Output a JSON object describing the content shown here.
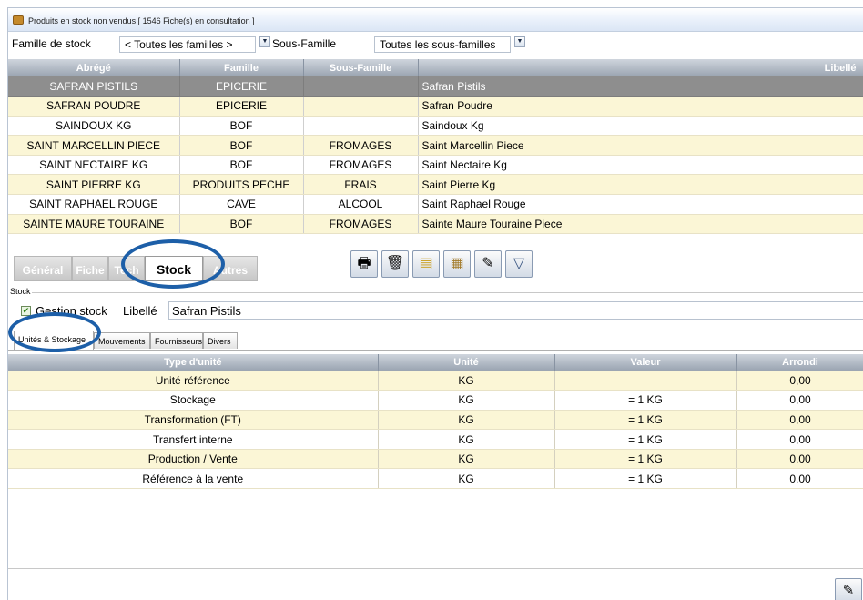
{
  "window": {
    "title": "Produits en stock non vendus  [ 1546 Fiche(s) en consultation ]"
  },
  "filters": {
    "famille_label": "Famille de stock",
    "famille_value": "< Toutes les familles >",
    "sous_famille_label": "Sous-Famille",
    "sous_famille_value": "Toutes les sous-familles"
  },
  "products_table": {
    "headers": [
      "Abrégé",
      "Famille",
      "Sous-Famille",
      "Libellé"
    ],
    "rows": [
      [
        "SAFRAN PISTILS",
        "EPICERIE",
        "",
        "Safran Pistils"
      ],
      [
        "SAFRAN POUDRE",
        "EPICERIE",
        "",
        "Safran Poudre"
      ],
      [
        "SAINDOUX KG",
        "BOF",
        "",
        "Saindoux Kg"
      ],
      [
        "SAINT MARCELLIN PIECE",
        "BOF",
        "FROMAGES",
        "Saint Marcellin Piece"
      ],
      [
        "SAINT NECTAIRE KG",
        "BOF",
        "FROMAGES",
        "Saint Nectaire Kg"
      ],
      [
        "SAINT PIERRE KG",
        "PRODUITS PECHE",
        "FRAIS",
        "Saint Pierre Kg"
      ],
      [
        "SAINT RAPHAEL ROUGE",
        "CAVE",
        "ALCOOL",
        "Saint Raphael Rouge"
      ],
      [
        "SAINTE MAURE TOURAINE",
        "BOF",
        "FROMAGES",
        "Sainte Maure Touraine Piece"
      ]
    ],
    "selected_row": 0
  },
  "detail_tabs": [
    "Général",
    "Fiche",
    "Tech",
    "Stock",
    "Autres"
  ],
  "detail_tab_active": "Stock",
  "toolbar_icons": [
    "print-icon",
    "bin-icon",
    "document-yellow-icon",
    "document-icon",
    "edit-icon",
    "filter-icon"
  ],
  "stock_group": {
    "caption": "Stock",
    "gestion_label": "Gestion stock",
    "gestion_checked": true,
    "libelle_label": "Libellé",
    "libelle_value": "Safran Pistils"
  },
  "sub_tabs": [
    "Unités & Stockage",
    "Mouvements",
    "Fournisseurs",
    "Divers"
  ],
  "sub_tab_active": "Unités & Stockage",
  "units_table": {
    "headers": [
      "Type d'unité",
      "Unité",
      "Valeur",
      "Arrondi"
    ],
    "rows": [
      [
        "Unité référence",
        "KG",
        "",
        "0,00"
      ],
      [
        "Stockage",
        "KG",
        "= 1 KG",
        "0,00"
      ],
      [
        "Transformation (FT)",
        "KG",
        "= 1 KG",
        "0,00"
      ],
      [
        "Transfert interne",
        "KG",
        "= 1 KG",
        "0,00"
      ],
      [
        "Production / Vente",
        "KG",
        "= 1 KG",
        "0,00"
      ],
      [
        "Référence à la vente",
        "KG",
        "= 1 KG",
        "0,00"
      ]
    ]
  },
  "colors": {
    "row_odd": "#fbf6d6",
    "row_selected": "#8e8e8e",
    "highlight_oval": "#1d5fa8"
  }
}
